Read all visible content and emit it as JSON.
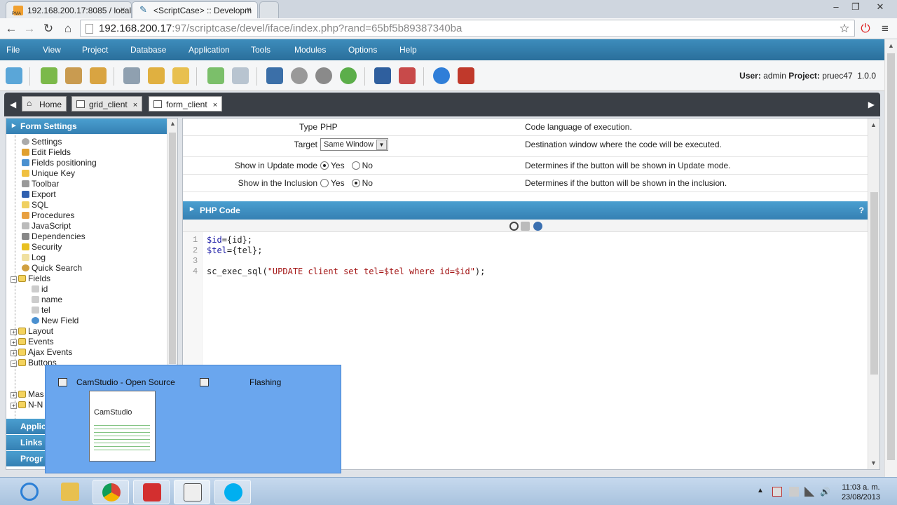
{
  "browser": {
    "tabs": [
      {
        "title": "192.168.200.17:8085 / local"
      },
      {
        "title": "<ScriptCase> :: Developm"
      }
    ],
    "url_host": "192.168.200.17",
    "url_rest": ":97/scriptcase/devel/iface/index.php?rand=65bf5b89387340ba",
    "pma_label": "PMA"
  },
  "menu": [
    "File",
    "View",
    "Project",
    "Database",
    "Application",
    "Tools",
    "Modules",
    "Options",
    "Help"
  ],
  "user": {
    "user_label": "User:",
    "user": "admin",
    "project_label": "Project:",
    "project": "pruec47",
    "version": "1.0.0"
  },
  "app_tabs": [
    {
      "label": "Home"
    },
    {
      "label": "grid_client",
      "close": "×"
    },
    {
      "label": "form_client",
      "close": "×"
    }
  ],
  "tree": {
    "header": "Form Settings",
    "items": [
      "Settings",
      "Edit Fields",
      "Fields positioning",
      "Unique Key",
      "Toolbar",
      "Export",
      "SQL",
      "Procedures",
      "JavaScript",
      "Dependencies",
      "Security",
      "Log",
      "Quick Search",
      "Fields",
      "id",
      "name",
      "tel",
      "New Field",
      "Layout",
      "Events",
      "Ajax Events",
      "Buttons",
      "Mas",
      "N-N"
    ],
    "collapsed": [
      "Applic",
      "Links",
      "Progr"
    ]
  },
  "props": [
    {
      "label": "Type",
      "value": "PHP",
      "desc": "Code language of execution."
    },
    {
      "label": "Target",
      "value": "Same Window",
      "desc": "Destination window where the code will be executed."
    },
    {
      "label": "Show in Update mode",
      "yes": "Yes",
      "no": "No",
      "desc": "Determines if the button will be shown in Update mode."
    },
    {
      "label": "Show in the Inclusion",
      "yes": "Yes",
      "no": "No",
      "desc": "Determines if the button will be shown in the inclusion."
    }
  ],
  "php": {
    "header": "PHP Code",
    "help": "?",
    "lines": [
      "1",
      "2",
      "3",
      "4"
    ],
    "code": {
      "l1_var": "$id",
      "l1_rest": "={id};",
      "l2_var": "$tel",
      "l2_rest": "={tel};",
      "l4_fn": "sc_exec_sql(",
      "l4_str": "\"UPDATE client set tel=$tel where id=$id\"",
      "l4_end": ");"
    }
  },
  "preview": {
    "item1": "CamStudio - Open Source",
    "item2": "Flashing",
    "thumb_logo": "CamStudio"
  },
  "taskbar": {
    "time": "11:03 a. m.",
    "date": "23/08/2013"
  }
}
